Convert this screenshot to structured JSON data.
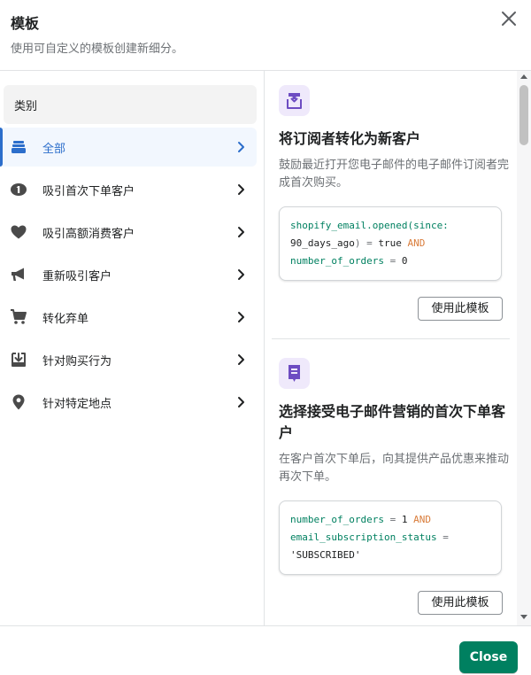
{
  "modal": {
    "title": "模板",
    "subtitle": "使用可自定义的模板创建新细分。",
    "close_icon": "close-icon"
  },
  "sidebar": {
    "header": "类别",
    "items": [
      {
        "label": "全部",
        "icon": "stack-icon",
        "active": true
      },
      {
        "label": "吸引首次下单客户",
        "icon": "first-order-icon",
        "active": false
      },
      {
        "label": "吸引高额消费客户",
        "icon": "heart-icon",
        "active": false
      },
      {
        "label": "重新吸引客户",
        "icon": "megaphone-icon",
        "active": false
      },
      {
        "label": "转化弃单",
        "icon": "cart-icon",
        "active": false
      },
      {
        "label": "针对购买行为",
        "icon": "download-box-icon",
        "active": false
      },
      {
        "label": "针对特定地点",
        "icon": "location-pin-icon",
        "active": false
      }
    ]
  },
  "templates": [
    {
      "icon": "email-subscribe-icon",
      "title": "将订阅者转化为新客户",
      "description": "鼓励最近打开您电子邮件的电子邮件订阅者完成首次购买。",
      "code": {
        "l1a": "shopify_email.opened(since:",
        "l2a": "90_days_ago",
        "l2b": ") = ",
        "l2c": "true",
        "l2d": " AND",
        "l3a": "number_of_orders",
        "l3b": " = ",
        "l3c": "0"
      },
      "button": "使用此模板"
    },
    {
      "icon": "email-marketing-icon",
      "title": "选择接受电子邮件营销的首次下单客户",
      "description": "在客户首次下单后，向其提供产品优惠来推动再次下单。",
      "code": {
        "l1a": "number_of_orders",
        "l1b": " = ",
        "l1c": "1",
        "l1d": " AND",
        "l2a": "email_subscription_status",
        "l2b": " =",
        "l3a": "'SUBSCRIBED'"
      },
      "button": "使用此模板"
    }
  ],
  "footer": {
    "close_label": "Close"
  },
  "colors": {
    "accent": "#2c6ecb",
    "primary_button": "#008060",
    "code_keyword": "#008060",
    "code_operator": "#d97c3a",
    "icon_bg": "#efe9fb",
    "icon_fg": "#6d4cc2"
  }
}
